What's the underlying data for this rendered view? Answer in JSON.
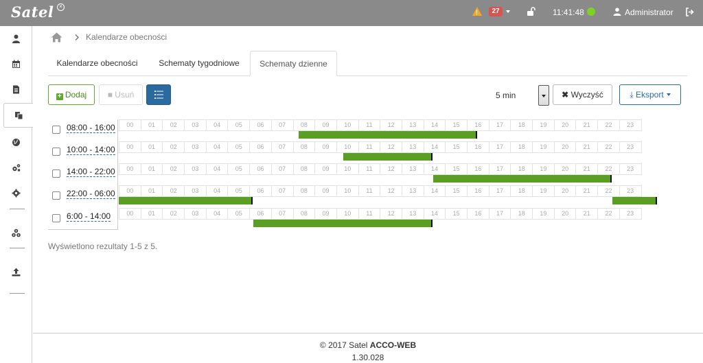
{
  "header": {
    "logo": "Satel",
    "alarm_count": "27",
    "time": "11:41:48",
    "user": "Administrator",
    "icons": [
      "warning-icon",
      "unlock-icon",
      "user-icon",
      "logout-icon"
    ],
    "colors": {
      "bar": "#8a8a8a",
      "badge": "#d9534f",
      "status": "#7ed321",
      "warning": "#f5a623"
    }
  },
  "sidebar": {
    "items": [
      {
        "icon": "user-icon"
      },
      {
        "icon": "calendar-icon"
      },
      {
        "icon": "document-icon"
      },
      {
        "icon": "copy-icon",
        "active": true
      },
      {
        "icon": "globe-icon"
      },
      {
        "icon": "cogs-icon"
      },
      {
        "icon": "gear-icon"
      },
      {
        "icon": "network-icon"
      },
      {
        "icon": "upload-icon"
      }
    ]
  },
  "breadcrumb": {
    "current": "Kalendarze obecności"
  },
  "tabs": [
    {
      "label": "Kalendarze obecności"
    },
    {
      "label": "Schematy tygodniowe"
    },
    {
      "label": "Schematy dzienne",
      "active": true
    }
  ],
  "toolbar": {
    "add_label": "Dodaj",
    "delete_label": "Usuń",
    "interval": "5 min",
    "clear_label": "Wyczyść",
    "export_label": "Eksport"
  },
  "hours": [
    "00",
    "01",
    "02",
    "03",
    "04",
    "05",
    "06",
    "07",
    "08",
    "09",
    "10",
    "11",
    "12",
    "13",
    "14",
    "15",
    "16",
    "17",
    "18",
    "19",
    "20",
    "21",
    "22",
    "23"
  ],
  "schedules": [
    {
      "name": "08:00 - 16:00",
      "segments": [
        [
          8,
          16
        ]
      ]
    },
    {
      "name": "10:00 - 14:00",
      "segments": [
        [
          10,
          14
        ]
      ]
    },
    {
      "name": "14:00 - 22:00",
      "segments": [
        [
          14,
          22
        ]
      ]
    },
    {
      "name": "22:00 - 06:00",
      "segments": [
        [
          0,
          6
        ],
        [
          22,
          24
        ]
      ]
    },
    {
      "name": "6:00 - 14:00",
      "segments": [
        [
          6,
          14
        ]
      ]
    }
  ],
  "segment_color": "#5a9e24",
  "result_text": "Wyświetlono rezultaty 1-5 z 5.",
  "footer": {
    "copyright": "© 2017 Satel ",
    "product": "ACCO-WEB",
    "version": "1.30.028"
  }
}
